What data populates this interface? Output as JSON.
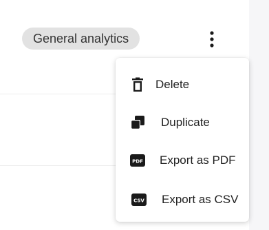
{
  "header": {
    "tag_label": "General analytics",
    "more_icon": "more-vertical-icon"
  },
  "menu": {
    "items": [
      {
        "label": "Delete",
        "icon": "trash-icon"
      },
      {
        "label": "Duplicate",
        "icon": "duplicate-icon"
      },
      {
        "label": "Export as PDF",
        "icon": "pdf-icon",
        "icon_text": "PDF"
      },
      {
        "label": "Export as CSV",
        "icon": "csv-icon",
        "icon_text": "CSV"
      }
    ]
  },
  "colors": {
    "tag_background": "#e2e2e2",
    "menu_background": "#ffffff",
    "icon": "#1a1a1a"
  }
}
